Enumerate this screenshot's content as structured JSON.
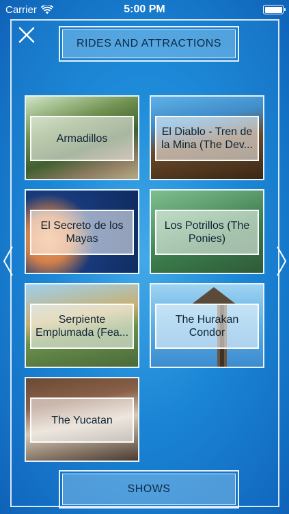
{
  "status_bar": {
    "carrier": "Carrier",
    "time": "5:00 PM"
  },
  "header": {
    "title": "RIDES AND ATTRACTIONS",
    "close_icon": "close-icon"
  },
  "attractions": [
    {
      "label": "Armadillos"
    },
    {
      "label": "El Diablo - Tren de la Mina (The Dev..."
    },
    {
      "label": "El Secreto de los Mayas"
    },
    {
      "label": "Los Potrillos (The Ponies)"
    },
    {
      "label": "Serpiente Emplumada (Fea..."
    },
    {
      "label": "The Hurakan Condor"
    },
    {
      "label": "The Yucatan"
    }
  ],
  "navigation": {
    "prev_icon": "chevron-left-icon",
    "next_icon": "chevron-right-icon"
  },
  "footer": {
    "shows_label": "SHOWS"
  },
  "colors": {
    "background": "#1c8ad8",
    "frame": "#ffffff",
    "label_text": "#0c2333"
  }
}
